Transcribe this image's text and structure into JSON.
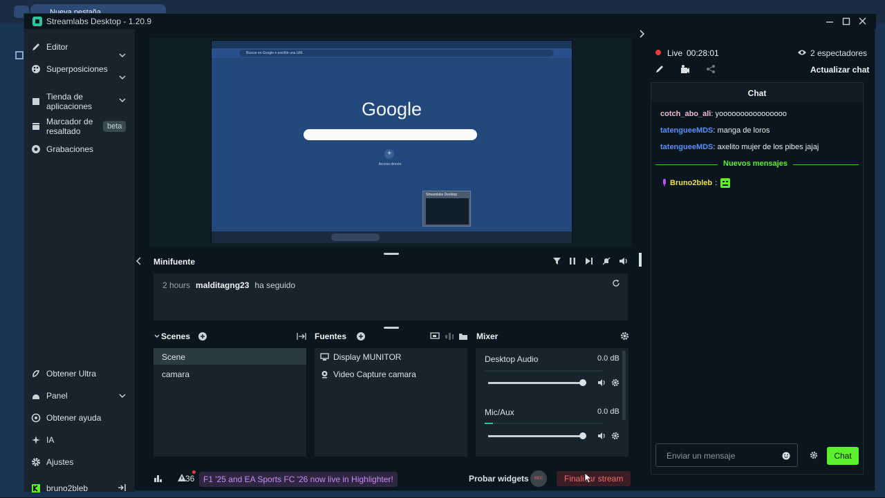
{
  "bg_browser": {
    "tab_title": "Nueva pestaña"
  },
  "app": {
    "title": "Streamlabs Desktop - 1.20.9"
  },
  "nav": {
    "items": [
      {
        "label": "Editor"
      },
      {
        "label": "Superposiciones"
      },
      {
        "label": "Tienda de aplicaciones"
      },
      {
        "label": "Marcador de resaltado",
        "badge": "beta"
      },
      {
        "label": "Grabaciones"
      }
    ],
    "bottom_items": [
      {
        "label": "Obtener Ultra"
      },
      {
        "label": "Panel"
      },
      {
        "label": "Obtener ayuda"
      },
      {
        "label": "IA"
      },
      {
        "label": "Ajustes"
      }
    ],
    "user": "bruno2bleb"
  },
  "preview": {
    "google_word": "Google",
    "search_placeholder": "Buscar en Google o escribir una URL",
    "shortcut_label": "Acceso directo",
    "thumb_label": "Streamlabs Desktop"
  },
  "minifuente": {
    "title": "Minifuente",
    "event_time": "2 hours",
    "event_user": "malditagng23",
    "event_action": "ha seguido"
  },
  "scenes": {
    "title": "Scenes",
    "items": [
      "Scene",
      "camara"
    ],
    "selected": "Scene"
  },
  "sources": {
    "title": "Fuentes",
    "items": [
      "Display MUNITOR",
      "Video Capture camara"
    ]
  },
  "mixer": {
    "title": "Mixer",
    "channels": [
      {
        "name": "Desktop Audio",
        "level": "0.0 dB",
        "volume": 0.98
      },
      {
        "name": "Mic/Aux",
        "level": "0.0 dB",
        "volume": 0.98
      }
    ]
  },
  "bottombar": {
    "alerts_count": "36",
    "news": "F1 '25 and EA Sports FC '26 now live in Highlighter!",
    "test_widgets": "Probar widgets",
    "rec": "REC",
    "end_stream": "Finalizar stream"
  },
  "status": {
    "live_label": "Live",
    "live_time": "00:28:01",
    "viewers": "2 espectadores",
    "refresh_chat": "Actualizar chat"
  },
  "chat": {
    "title": "Chat",
    "messages": [
      {
        "user": "cotch_abo_ali",
        "text": "yoooooooooooooooo",
        "color": "#f5b7cf"
      },
      {
        "user": "tatengueeMDS",
        "text": "manga de loros",
        "color": "#5b8dff"
      },
      {
        "user": "tatengueeMDS",
        "text": "axelito mujer de los pibes jajaj",
        "color": "#5b8dff"
      }
    ],
    "new_messages": "Nuevos mensajes",
    "new_user": "Bruno2bleb",
    "new_user_color": "#f0e04b",
    "input_placeholder": "Enviar un mensaje",
    "send_label": "Chat"
  },
  "colors": {
    "accent": "#31c3a2",
    "live": "#e83c3c",
    "green": "#5cf02c",
    "bg": "#09161d",
    "panel": "#17242d"
  }
}
